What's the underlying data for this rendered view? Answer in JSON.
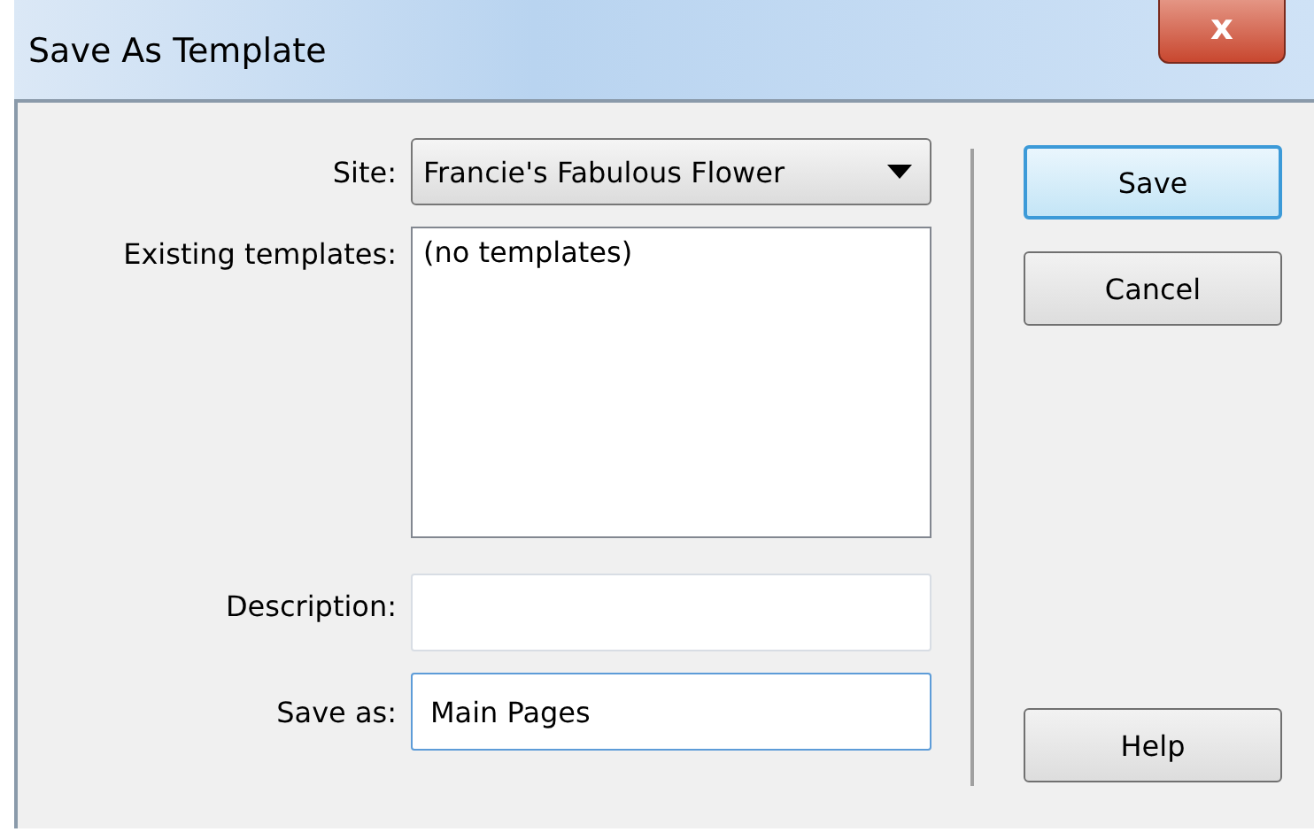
{
  "window": {
    "title": "Save As Template",
    "close": "x"
  },
  "form": {
    "site": {
      "label": "Site:",
      "value": "Francie's Fabulous Flower"
    },
    "existing_templates": {
      "label": "Existing templates:",
      "items": [
        "(no templates)"
      ]
    },
    "description": {
      "label": "Description:",
      "focused": false
    },
    "save_as": {
      "label": "Save as:",
      "value": "Main Pages",
      "focused": true
    }
  },
  "buttons": [
    {
      "label": "Save",
      "default": true
    },
    {
      "label": "Cancel",
      "default": false
    },
    {
      "label": "Help",
      "default": false
    }
  ]
}
